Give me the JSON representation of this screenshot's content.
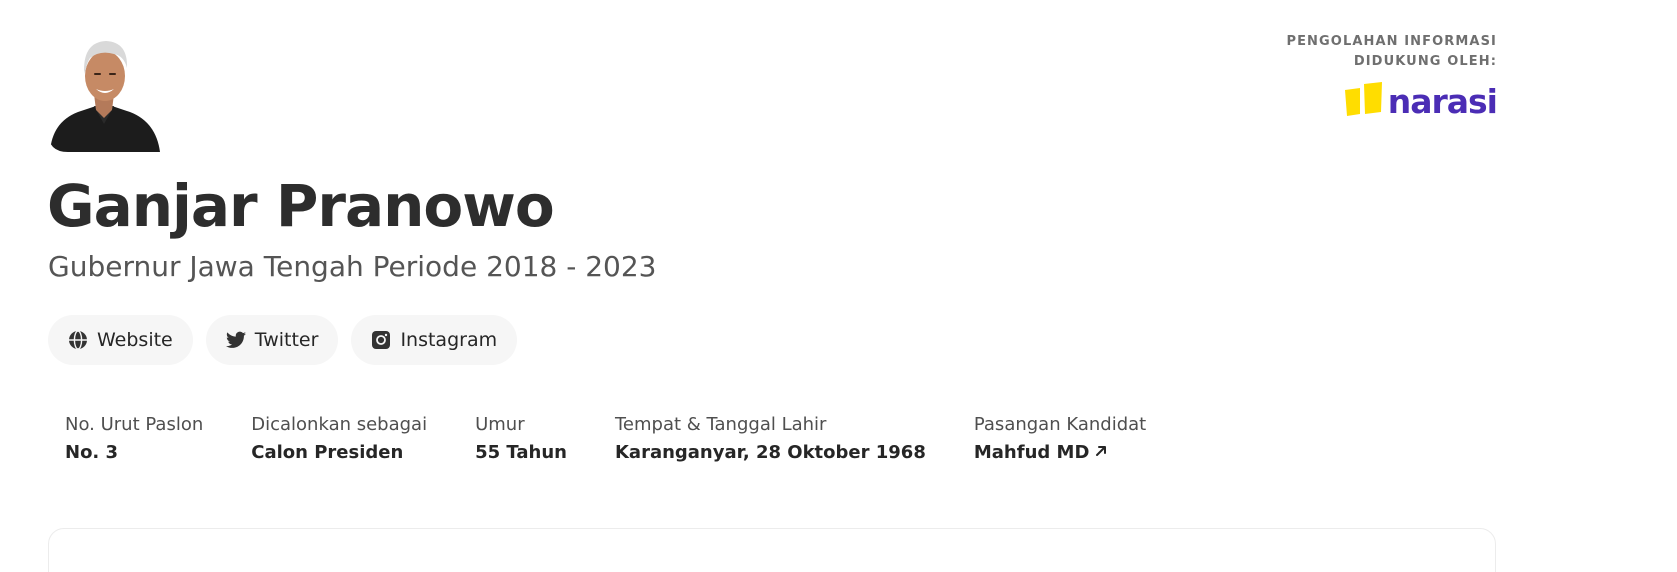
{
  "sponsor": {
    "label_line1": "PENGOLAHAN INFORMASI",
    "label_line2": "DIDUKUNG OLEH:",
    "logo_text": "narasi",
    "logo_colors": {
      "accent": "#ffdd00",
      "text": "#4b2db5"
    }
  },
  "candidate": {
    "name": "Ganjar Pranowo",
    "subtitle": "Gubernur Jawa Tengah Periode 2018 - 2023"
  },
  "links": [
    {
      "label": "Website",
      "icon": "globe-icon"
    },
    {
      "label": "Twitter",
      "icon": "twitter-icon"
    },
    {
      "label": "Instagram",
      "icon": "instagram-icon"
    }
  ],
  "facts": [
    {
      "label": "No. Urut Paslon",
      "value": "No. 3"
    },
    {
      "label": "Dicalonkan sebagai",
      "value": "Calon Presiden"
    },
    {
      "label": "Umur",
      "value": "55 Tahun"
    },
    {
      "label": "Tempat & Tanggal Lahir",
      "value": "Karanganyar, 28 Oktober 1968"
    },
    {
      "label": "Pasangan Kandidat",
      "value": "Mahfud MD",
      "icon": "arrow-up-right-icon"
    }
  ]
}
